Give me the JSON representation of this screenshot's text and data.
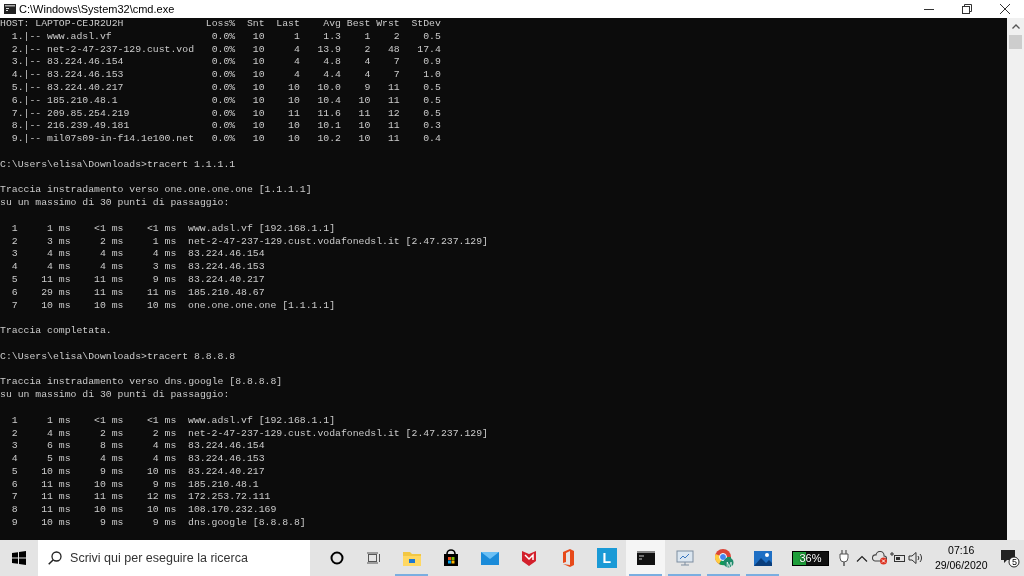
{
  "window": {
    "title": "C:\\Windows\\System32\\cmd.exe"
  },
  "console": [
    {
      "kind": "mtr_header",
      "host": "HOST: LAPTOP-CEJR2U2H",
      "columns": [
        "Loss%",
        "Snt",
        "Last",
        "Avg",
        "Best",
        "Wrst",
        "StDev"
      ]
    },
    {
      "kind": "mtr_row",
      "hop": "1.",
      "host": "|-- www.adsl.vf",
      "values": [
        "0.0%",
        "10",
        "1",
        "1.3",
        "1",
        "2",
        "0.5"
      ]
    },
    {
      "kind": "mtr_row",
      "hop": "2.",
      "host": "|-- net-2-47-237-129.cust.vod",
      "values": [
        "0.0%",
        "10",
        "4",
        "13.9",
        "2",
        "48",
        "17.4"
      ]
    },
    {
      "kind": "mtr_row",
      "hop": "3.",
      "host": "|-- 83.224.46.154",
      "values": [
        "0.0%",
        "10",
        "4",
        "4.8",
        "4",
        "7",
        "0.9"
      ]
    },
    {
      "kind": "mtr_row",
      "hop": "4.",
      "host": "|-- 83.224.46.153",
      "values": [
        "0.0%",
        "10",
        "4",
        "4.4",
        "4",
        "7",
        "1.0"
      ]
    },
    {
      "kind": "mtr_row",
      "hop": "5.",
      "host": "|-- 83.224.40.217",
      "values": [
        "0.0%",
        "10",
        "10",
        "10.0",
        "9",
        "11",
        "0.5"
      ]
    },
    {
      "kind": "mtr_row",
      "hop": "6.",
      "host": "|-- 185.210.48.1",
      "values": [
        "0.0%",
        "10",
        "10",
        "10.4",
        "10",
        "11",
        "0.5"
      ]
    },
    {
      "kind": "mtr_row",
      "hop": "7.",
      "host": "|-- 209.85.254.219",
      "values": [
        "0.0%",
        "10",
        "11",
        "11.6",
        "11",
        "12",
        "0.5"
      ]
    },
    {
      "kind": "mtr_row",
      "hop": "8.",
      "host": "|-- 216.239.49.181",
      "values": [
        "0.0%",
        "10",
        "10",
        "10.1",
        "10",
        "11",
        "0.3"
      ]
    },
    {
      "kind": "mtr_row",
      "hop": "9.",
      "host": "|-- mil07s09-in-f14.1e100.net",
      "values": [
        "0.0%",
        "10",
        "10",
        "10.2",
        "10",
        "11",
        "0.4"
      ]
    },
    {
      "kind": "blank"
    },
    {
      "kind": "prompt",
      "text": "C:\\Users\\elisa\\Downloads>tracert 1.1.1.1"
    },
    {
      "kind": "blank"
    },
    {
      "kind": "text",
      "text": "Traccia instradamento verso one.one.one.one [1.1.1.1]"
    },
    {
      "kind": "text",
      "text": "su un massimo di 30 punti di passaggio:"
    },
    {
      "kind": "blank"
    },
    {
      "kind": "hop",
      "hop": "1",
      "times": [
        "1 ms",
        "<1 ms",
        "<1 ms"
      ],
      "host": "www.adsl.vf [192.168.1.1]"
    },
    {
      "kind": "hop",
      "hop": "2",
      "times": [
        "3 ms",
        "2 ms",
        "1 ms"
      ],
      "host": "net-2-47-237-129.cust.vodafonedsl.it [2.47.237.129]"
    },
    {
      "kind": "hop",
      "hop": "3",
      "times": [
        "4 ms",
        "4 ms",
        "4 ms"
      ],
      "host": "83.224.46.154"
    },
    {
      "kind": "hop",
      "hop": "4",
      "times": [
        "4 ms",
        "4 ms",
        "3 ms"
      ],
      "host": "83.224.46.153"
    },
    {
      "kind": "hop",
      "hop": "5",
      "times": [
        "11 ms",
        "11 ms",
        "9 ms"
      ],
      "host": "83.224.40.217"
    },
    {
      "kind": "hop",
      "hop": "6",
      "times": [
        "29 ms",
        "11 ms",
        "11 ms"
      ],
      "host": "185.210.48.67"
    },
    {
      "kind": "hop",
      "hop": "7",
      "times": [
        "10 ms",
        "10 ms",
        "10 ms"
      ],
      "host": "one.one.one.one [1.1.1.1]"
    },
    {
      "kind": "blank"
    },
    {
      "kind": "text",
      "text": "Traccia completata."
    },
    {
      "kind": "blank"
    },
    {
      "kind": "prompt",
      "text": "C:\\Users\\elisa\\Downloads>tracert 8.8.8.8"
    },
    {
      "kind": "blank"
    },
    {
      "kind": "text",
      "text": "Traccia instradamento verso dns.google [8.8.8.8]"
    },
    {
      "kind": "text",
      "text": "su un massimo di 30 punti di passaggio:"
    },
    {
      "kind": "blank"
    },
    {
      "kind": "hop",
      "hop": "1",
      "times": [
        "1 ms",
        "<1 ms",
        "<1 ms"
      ],
      "host": "www.adsl.vf [192.168.1.1]"
    },
    {
      "kind": "hop",
      "hop": "2",
      "times": [
        "4 ms",
        "2 ms",
        "2 ms"
      ],
      "host": "net-2-47-237-129.cust.vodafonedsl.it [2.47.237.129]"
    },
    {
      "kind": "hop",
      "hop": "3",
      "times": [
        "6 ms",
        "8 ms",
        "4 ms"
      ],
      "host": "83.224.46.154"
    },
    {
      "kind": "hop",
      "hop": "4",
      "times": [
        "5 ms",
        "4 ms",
        "4 ms"
      ],
      "host": "83.224.46.153"
    },
    {
      "kind": "hop",
      "hop": "5",
      "times": [
        "10 ms",
        "9 ms",
        "10 ms"
      ],
      "host": "83.224.40.217"
    },
    {
      "kind": "hop",
      "hop": "6",
      "times": [
        "11 ms",
        "10 ms",
        "9 ms"
      ],
      "host": "185.210.48.1"
    },
    {
      "kind": "hop",
      "hop": "7",
      "times": [
        "11 ms",
        "11 ms",
        "12 ms"
      ],
      "host": "172.253.72.111"
    },
    {
      "kind": "hop",
      "hop": "8",
      "times": [
        "11 ms",
        "10 ms",
        "10 ms"
      ],
      "host": "108.170.232.169"
    },
    {
      "kind": "hop",
      "hop": "9",
      "times": [
        "10 ms",
        "9 ms",
        "9 ms"
      ],
      "host": "dns.google [8.8.8.8]"
    }
  ],
  "taskbar": {
    "search": {
      "placeholder": "Scrivi qui per eseguire la ricerca"
    },
    "apps": [
      {
        "kind": "folder",
        "running": true,
        "selected": false
      },
      {
        "kind": "store",
        "running": false,
        "selected": false
      },
      {
        "kind": "mail",
        "running": false,
        "selected": false
      },
      {
        "kind": "shield",
        "running": false,
        "selected": false
      },
      {
        "kind": "office",
        "running": false,
        "selected": false
      },
      {
        "kind": "letter",
        "label": "L",
        "running": false,
        "selected": false
      },
      {
        "kind": "terminal",
        "running": true,
        "selected": true
      },
      {
        "kind": "monitor",
        "running": true,
        "selected": false
      },
      {
        "kind": "browser",
        "badge": "M",
        "running": true,
        "selected": false
      },
      {
        "kind": "photo",
        "running": true,
        "selected": false
      }
    ],
    "battery": {
      "reading": "36%",
      "level": 0.36
    },
    "clock": {
      "time": "07:16",
      "date": "29/06/2020"
    },
    "notifications": {
      "count": "5"
    }
  }
}
